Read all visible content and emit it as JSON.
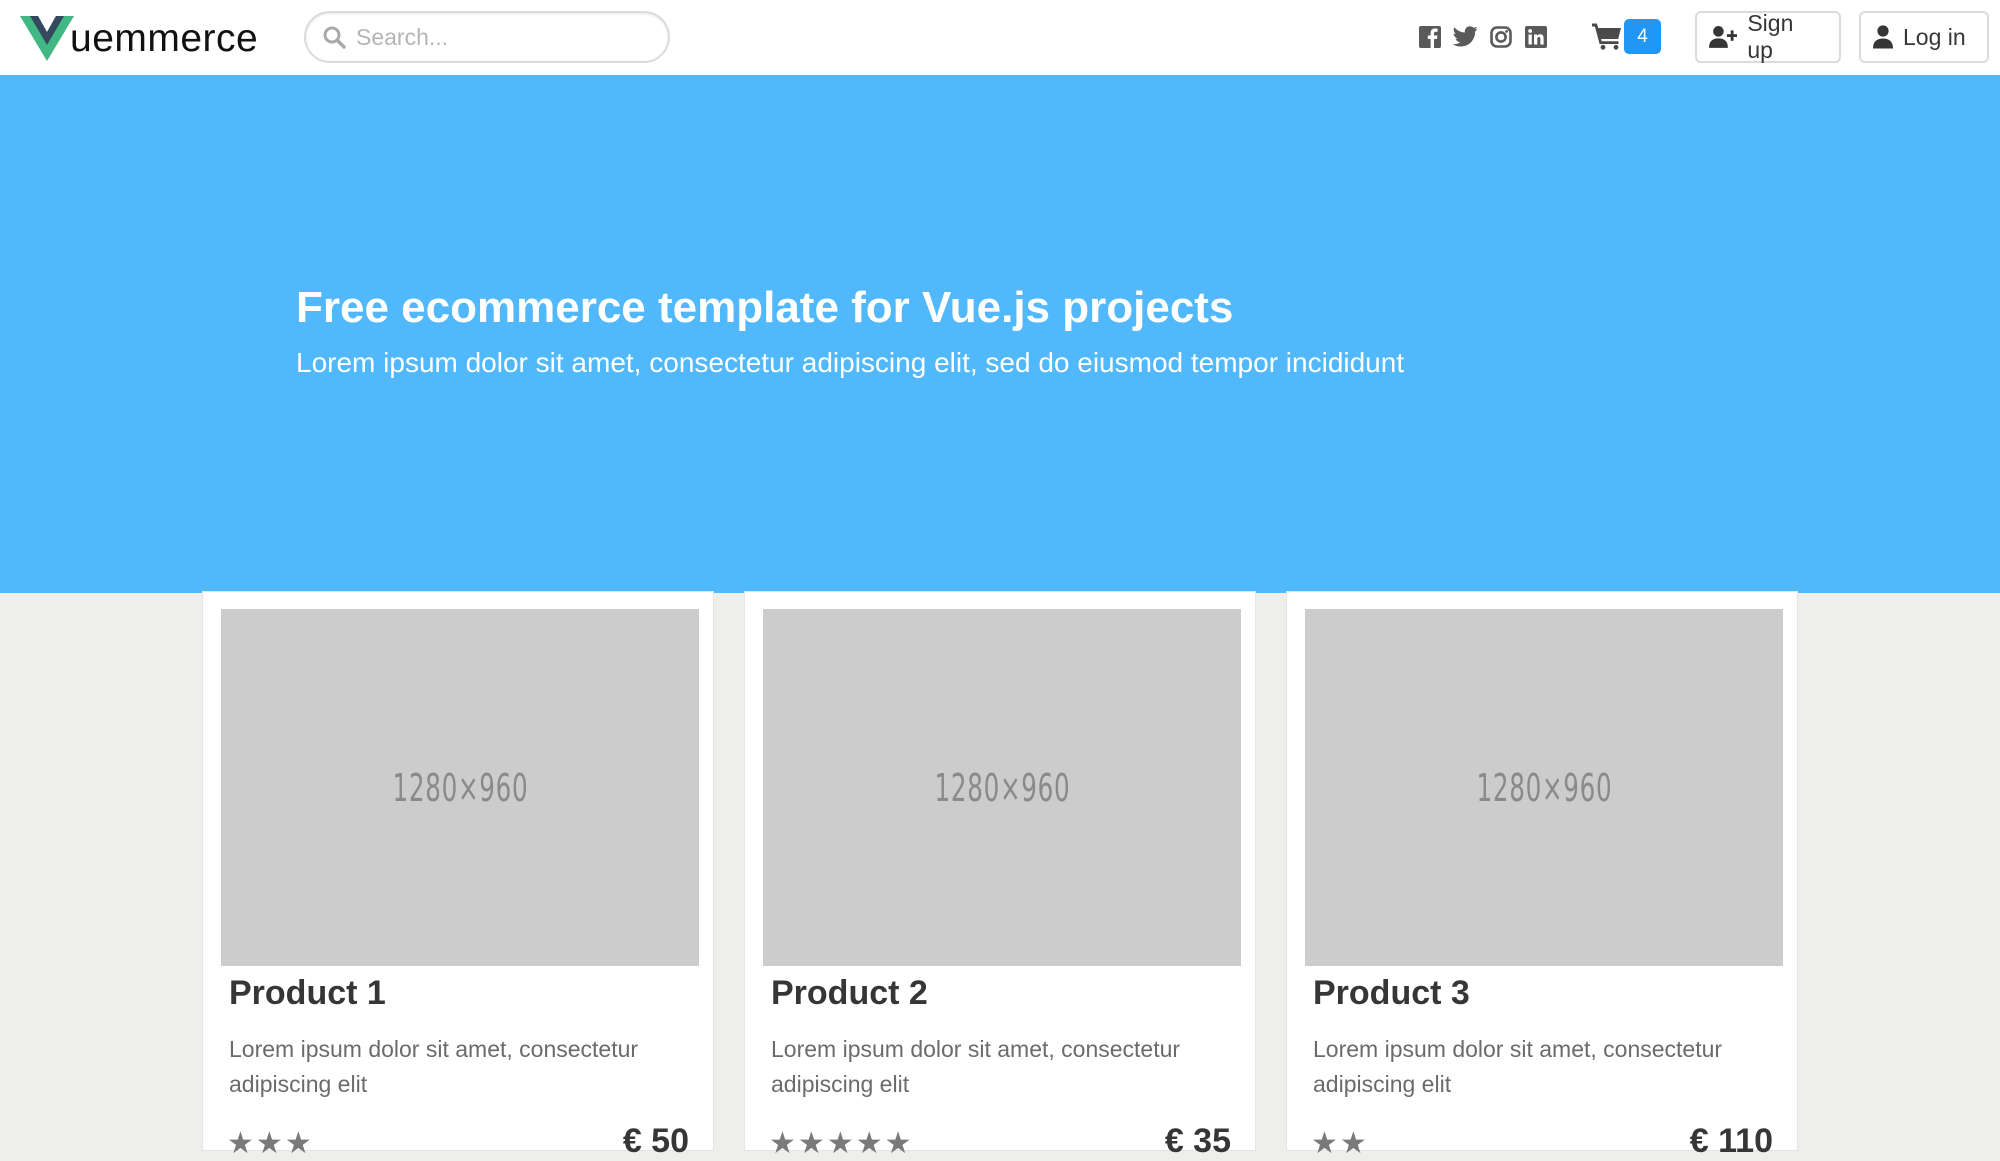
{
  "brand": {
    "name": "uemmerce",
    "logo_letter": "V"
  },
  "search": {
    "placeholder": "Search..."
  },
  "social": [
    "facebook-icon",
    "twitter-icon",
    "instagram-icon",
    "linkedin-icon"
  ],
  "cart": {
    "count": "4"
  },
  "nav": {
    "signup_label": "Sign up",
    "login_label": "Log in"
  },
  "hero": {
    "title": "Free ecommerce template for Vue.js projects",
    "subtitle": "Lorem ipsum dolor sit amet, consectetur adipiscing elit, sed do eiusmod tempor incididunt"
  },
  "products": [
    {
      "image_label": "1280×960",
      "title": "Product 1",
      "description": "Lorem ipsum dolor sit amet, consectetur adipiscing elit",
      "rating": 3,
      "price": "€ 50"
    },
    {
      "image_label": "1280×960",
      "title": "Product 2",
      "description": "Lorem ipsum dolor sit amet, consectetur adipiscing elit",
      "rating": 5,
      "price": "€ 35"
    },
    {
      "image_label": "1280×960",
      "title": "Product 3",
      "description": "Lorem ipsum dolor sit amet, consectetur adipiscing elit",
      "rating": 2,
      "price": "€ 110"
    }
  ],
  "colors": {
    "hero_bg": "#51b9fb",
    "cart_badge": "#2196f3",
    "logo_green": "#41b883",
    "logo_dark": "#35495e"
  }
}
